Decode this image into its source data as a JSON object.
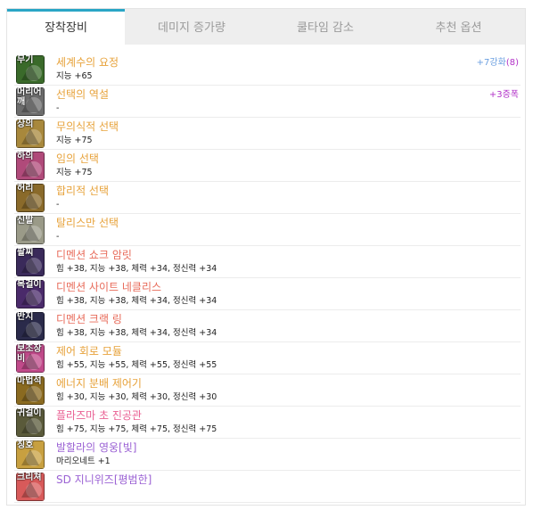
{
  "tabs": [
    "장착장비",
    "데미지 증가량",
    "쿨타임 감소",
    "추천 옵션"
  ],
  "items": [
    {
      "slot": "무기",
      "name": "세계수의 요정",
      "grade": "rare",
      "stats": "지능 +65",
      "extra": "+7강화",
      "extra2": "(8)",
      "icon": "weapon-icon",
      "bg": "#3a6a2a"
    },
    {
      "slot": "머리어깨",
      "name": "선택의 역설",
      "grade": "rare",
      "stats": "-",
      "extra": "+3증폭",
      "icon": "shoulder-icon",
      "bg": "#6c6c6c"
    },
    {
      "slot": "상의",
      "name": "무의식적 선택",
      "grade": "rare",
      "stats": "지능 +75",
      "icon": "top-icon",
      "bg": "#a8883c"
    },
    {
      "slot": "하의",
      "name": "임의 선택",
      "grade": "rare",
      "stats": "지능 +75",
      "icon": "bottom-icon",
      "bg": "#b04a7a"
    },
    {
      "slot": "허리",
      "name": "합리적 선택",
      "grade": "rare",
      "stats": "-",
      "icon": "belt-icon",
      "bg": "#8a6a2a"
    },
    {
      "slot": "신발",
      "name": "탈리스만 선택",
      "grade": "rare",
      "stats": "-",
      "icon": "shoes-icon",
      "bg": "#9a9a88"
    },
    {
      "slot": "팔찌",
      "name": "디멘션 쇼크 암릿",
      "grade": "unique",
      "stats": "힘 +38, 지능 +38, 체력 +34, 정신력 +34",
      "icon": "bracelet-icon",
      "bg": "#3a2a5a"
    },
    {
      "slot": "목걸이",
      "name": "디멘션 사이트 네클리스",
      "grade": "unique",
      "stats": "힘 +38, 지능 +38, 체력 +34, 정신력 +34",
      "icon": "necklace-icon",
      "bg": "#4a2a6a"
    },
    {
      "slot": "반지",
      "name": "디멘션 크랙 링",
      "grade": "unique",
      "stats": "힘 +38, 지능 +38, 체력 +34, 정신력 +34",
      "icon": "ring-icon",
      "bg": "#2a2a4a"
    },
    {
      "slot": "보조장비",
      "name": "제어 회로 모듈",
      "grade": "rare",
      "stats": "힘 +55, 지능 +55, 체력 +55, 정신력 +55",
      "icon": "subweapon-icon",
      "bg": "#c04a8a"
    },
    {
      "slot": "마법석",
      "name": "에너지 분배 제어기",
      "grade": "rare",
      "stats": "힘 +30, 지능 +30, 체력 +30, 정신력 +30",
      "icon": "magicstone-icon",
      "bg": "#8a6a20"
    },
    {
      "slot": "귀걸이",
      "name": "플라즈마 초 진공관",
      "grade": "legend",
      "stats": "힘 +75, 지능 +75, 체력 +75, 정신력 +75",
      "icon": "earring-icon",
      "bg": "#5a5a3a"
    },
    {
      "slot": "칭호",
      "name": "발할라의 영웅[빛]",
      "grade": "purple",
      "stats": "마리오네트 +1",
      "icon": "title-icon",
      "bg": "#c8a040"
    },
    {
      "slot": "크리쳐",
      "name": "SD 지니위즈[평범한]",
      "grade": "purple",
      "stats": "",
      "icon": "creature-icon",
      "bg": "#d85a5a"
    }
  ]
}
